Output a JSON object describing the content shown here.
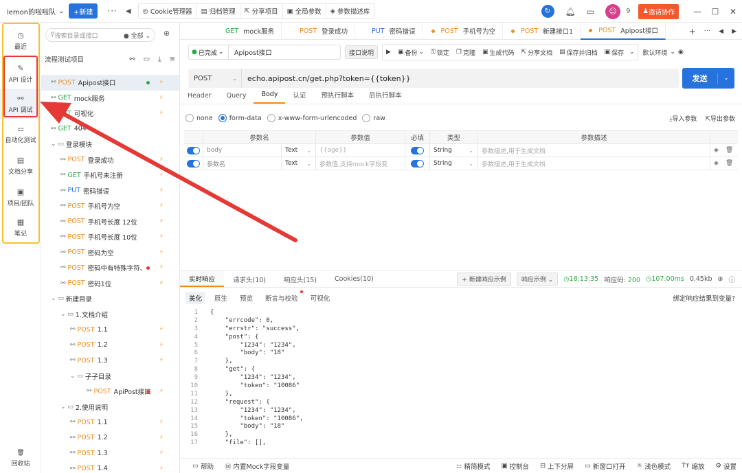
{
  "topbar": {
    "team": "lemon的啦啦队",
    "new_btn": "+新建",
    "tools": [
      "Cookie管理器",
      "归档管理",
      "分享项目",
      "全局参数",
      "参数描述库"
    ],
    "avatar_count": "9",
    "invite": "邀请协作"
  },
  "leftnav": {
    "items": [
      "最近",
      "API 设计",
      "API 调试",
      "自动化测试",
      "文档分享",
      "项目/团队",
      "笔记"
    ],
    "recycle": "回收站"
  },
  "tree": {
    "search_placeholder": "搜索目录或接口",
    "filter": "全部",
    "section": "流程测试项目",
    "items": [
      {
        "method": "POST",
        "name": "Apipost接口"
      },
      {
        "method": "GET",
        "name": "mock服务"
      },
      {
        "method": "GET",
        "name": "可视化"
      },
      {
        "method": "GET",
        "name": "404"
      },
      {
        "method": "",
        "name": "登录模块"
      },
      {
        "method": "POST",
        "name": "登录成功"
      },
      {
        "method": "GET",
        "name": "手机号未注册"
      },
      {
        "method": "PUT",
        "name": "密码错误"
      },
      {
        "method": "POST",
        "name": "手机号为空"
      },
      {
        "method": "POST",
        "name": "手机号长度 12位"
      },
      {
        "method": "POST",
        "name": "手机号长度 10位"
      },
      {
        "method": "POST",
        "name": "密码为空"
      },
      {
        "method": "POST",
        "name": "密码中有特殊字符、"
      },
      {
        "method": "POST",
        "name": "密码1位"
      },
      {
        "method": "",
        "name": "新建目录"
      },
      {
        "method": "",
        "name": "1.文档介绍"
      },
      {
        "method": "POST",
        "name": "1.1"
      },
      {
        "method": "POST",
        "name": "1.2"
      },
      {
        "method": "POST",
        "name": "1.3"
      },
      {
        "method": "",
        "name": "子子目录"
      },
      {
        "method": "POST",
        "name": "ApiPost接口"
      },
      {
        "method": "",
        "name": "2.使用说明"
      },
      {
        "method": "POST",
        "name": "1.1"
      },
      {
        "method": "POST",
        "name": "1.2"
      },
      {
        "method": "POST",
        "name": "1.3"
      },
      {
        "method": "POST",
        "name": "1.4"
      }
    ]
  },
  "tabs": [
    {
      "method": "GET",
      "name": "mock服务"
    },
    {
      "method": "POST",
      "name": "登录成功"
    },
    {
      "method": "PUT",
      "name": "密码错误"
    },
    {
      "method": "POST",
      "name": "手机号为空"
    },
    {
      "method": "POST",
      "name": "新建接口1"
    },
    {
      "method": "POST",
      "name": "Apipost接口"
    }
  ],
  "toolbar": {
    "status": "已完成",
    "name": "Apipost接口",
    "doc": "接口说明",
    "actions": [
      "备份",
      "锁定",
      "克隆",
      "生成代码",
      "分享文档",
      "保存并归档",
      "保存"
    ],
    "env": "默认环境"
  },
  "request": {
    "method": "POST",
    "url": "echo.apipost.cn/get.php?token={{token}}",
    "send": "发送",
    "tabs": [
      "Header",
      "Query",
      "Body",
      "认证",
      "预执行脚本",
      "后执行脚本"
    ],
    "body_types": [
      "none",
      "form-data",
      "x-www-form-urlencoded",
      "raw"
    ],
    "import": "导入参数",
    "export": "导出参数",
    "columns": [
      "参数名",
      "参数值",
      "必填",
      "类型",
      "参数描述"
    ],
    "rows": [
      {
        "name": "body",
        "type": "Text",
        "value": "{{age}}",
        "vtype": "String",
        "desc": "参数描述,用于生成文档"
      },
      {
        "name": "参数名",
        "type": "Text",
        "value": "参数值,支持mock字段变",
        "vtype": "String",
        "desc": "参数描述,用于生成文档"
      }
    ]
  },
  "response": {
    "tabs": [
      "实时响应",
      "请求头(10)",
      "响应头(15)",
      "Cookies(10)"
    ],
    "new_example": "+ 新建响应示例",
    "example": "响应示例",
    "time": "18:13:35",
    "code_label": "响应码:",
    "code": "200",
    "duration": "107.00ms",
    "size": "0.45kb",
    "view_tabs": [
      "美化",
      "原生",
      "预览",
      "断言与校验",
      "可视化"
    ],
    "bind": "绑定响应结果到变量?",
    "lines": [
      "{",
      "    \"errcode\": 0,",
      "    \"errstr\": \"success\",",
      "    \"post\": {",
      "        \"1234\": \"1234\",",
      "        \"body\": \"18\"",
      "    },",
      "    \"get\": {",
      "        \"1234\": \"1234\",",
      "        \"token\": \"10086\"",
      "    },",
      "    \"request\": {",
      "        \"1234\": \"1234\",",
      "        \"token\": \"10086\",",
      "        \"body\": \"18\"",
      "    },",
      "    \"file\": [],"
    ]
  },
  "footer": {
    "left": [
      "帮助",
      "内置Mock字段变量"
    ],
    "right": [
      "精简模式",
      "控制台",
      "上下分屏",
      "新窗口打开",
      "浅色模式",
      "缩放",
      "设置"
    ]
  },
  "colors": {
    "primary": "#2673dd",
    "post": "#f08c1a",
    "get": "#2aa844",
    "invite": "#f3592d",
    "highlight": "#f6c12c",
    "arrow": "#e53935"
  }
}
